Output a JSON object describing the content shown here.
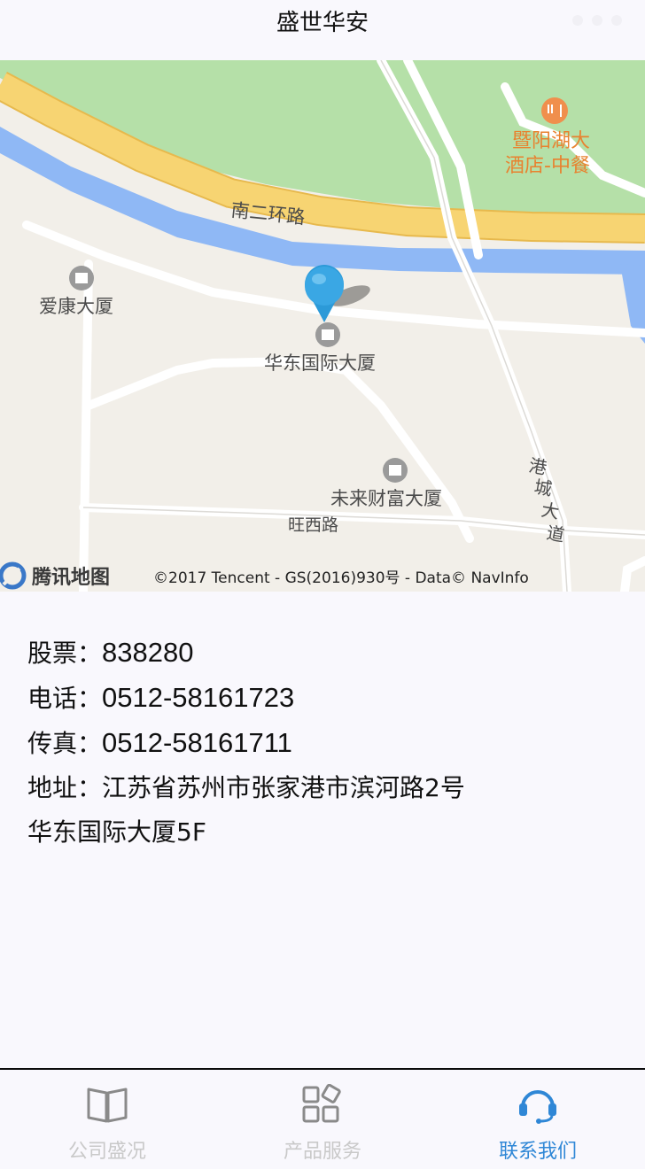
{
  "header": {
    "title": "盛世华安",
    "more_icon": "ellipsis-icon"
  },
  "map": {
    "labels": {
      "ring_road": "南二环路",
      "restaurant": "暨阳湖大",
      "restaurant_2": "酒店-中餐",
      "aikang": "爱康大厦",
      "huadong": "华东国际大厦",
      "weilai": "未来财富大厦",
      "wangxi": "旺西路",
      "gangcheng_1": "港",
      "gangcheng_2": "城",
      "gangcheng_3": "大",
      "gangcheng_4": "道"
    },
    "logo_text": "腾讯地图",
    "copyright": "©2017 Tencent - GS(2016)930号 - Data© NavInfo",
    "marker_icon": "location-pin-icon",
    "colors": {
      "water": "#8fb8f5",
      "park": "#b5e0a8",
      "ring_road": "#f7d472",
      "land": "#f2efe9"
    }
  },
  "contact": {
    "stock_label": "股票：",
    "stock_value": "838280",
    "phone_label": "电话：",
    "phone_value": "0512-58161723",
    "fax_label": "传真：",
    "fax_value": "0512-58161711",
    "address_label": "地址：",
    "address_line1": "江苏省苏州市张家港市滨河路2号",
    "address_line2": "华东国际大厦5F"
  },
  "tabbar": {
    "active_color": "#2f87d6",
    "inactive_color": "#c9c9c9",
    "tabs": [
      {
        "label": "公司盛况",
        "icon": "book-icon",
        "active": false
      },
      {
        "label": "产品服务",
        "icon": "grid-icon",
        "active": false
      },
      {
        "label": "联系我们",
        "icon": "headset-icon",
        "active": true
      }
    ]
  }
}
